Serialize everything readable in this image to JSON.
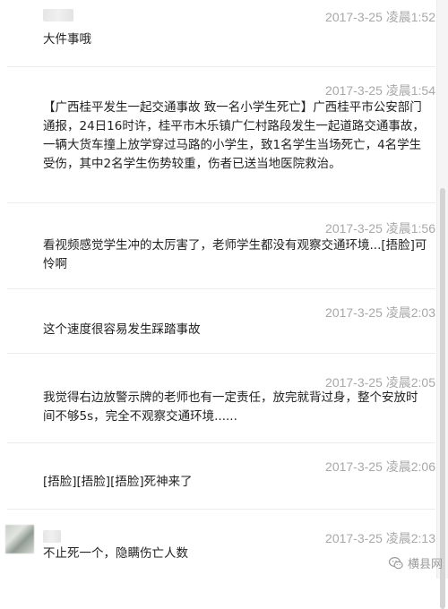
{
  "comments": [
    {
      "timestamp": "2017-3-25 凌晨1:52",
      "text": "大件事哦"
    },
    {
      "timestamp": "2017-3-25 凌晨1:54",
      "text": "【广西桂平发生一起交通事故 致一名小学生死亡】广西桂平市公安部门通报，24日16时许，桂平市木乐镇广仁村路段发生一起道路交通事故，一辆大货车撞上放学穿过马路的小学生，致1名学生当场死亡，4名学生受伤，其中2名学生伤势较重，伤者已送当地医院救治。"
    },
    {
      "timestamp": "2017-3-25 凌晨1:56",
      "text": "看视频感觉学生冲的太厉害了，老师学生都没有观察交通环境...[捂脸]可怜啊"
    },
    {
      "timestamp": "2017-3-25 凌晨2:03",
      "text": "这个速度很容易发生踩踏事故"
    },
    {
      "timestamp": "2017-3-25 凌晨2:05",
      "text": "我觉得右边放警示牌的老师也有一定责任，放完就背过身，整个安放时间不够5s，完全不观察交通环境......"
    },
    {
      "timestamp": "2017-3-25 凌晨2:06",
      "text": "[捂脸][捂脸][捂脸]死神来了"
    },
    {
      "timestamp": "2017-3-25 凌晨2:13",
      "text": "不止死一个，隐瞒伤亡人数"
    }
  ],
  "watermark": {
    "text": "横县网",
    "icon": "wechat-icon"
  }
}
